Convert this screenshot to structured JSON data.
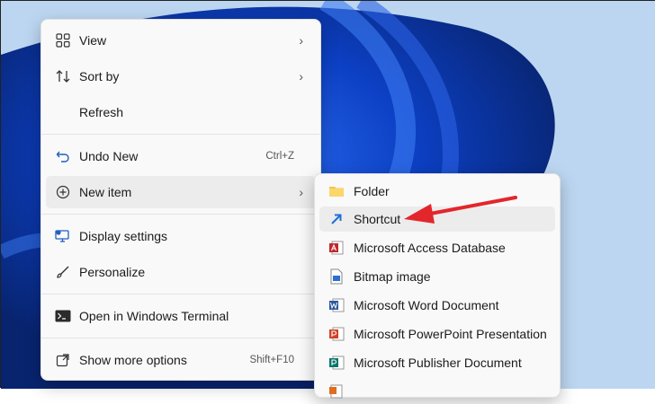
{
  "context_menu": {
    "items": [
      {
        "label": "View",
        "has_submenu": true
      },
      {
        "label": "Sort by",
        "has_submenu": true
      },
      {
        "label": "Refresh"
      },
      {
        "label": "Undo New",
        "shortcut": "Ctrl+Z"
      },
      {
        "label": "New item",
        "has_submenu": true
      },
      {
        "label": "Display settings"
      },
      {
        "label": "Personalize"
      },
      {
        "label": "Open in Windows Terminal"
      },
      {
        "label": "Show more options",
        "shortcut": "Shift+F10"
      }
    ],
    "chevron": "›"
  },
  "new_item_submenu": {
    "items": [
      {
        "label": "Folder",
        "icon": "folder-icon"
      },
      {
        "label": "Shortcut",
        "icon": "shortcut-icon"
      },
      {
        "label": "Microsoft Access Database",
        "icon": "access-icon"
      },
      {
        "label": "Bitmap image",
        "icon": "bitmap-icon"
      },
      {
        "label": "Microsoft Word Document",
        "icon": "word-icon"
      },
      {
        "label": "Microsoft PowerPoint Presentation",
        "icon": "powerpoint-icon"
      },
      {
        "label": "Microsoft Publisher Document",
        "icon": "publisher-icon"
      }
    ]
  },
  "colors": {
    "accent_arrow": "#e3262c",
    "folder": "#f4c24d",
    "shortcut": "#1d6fd6"
  }
}
